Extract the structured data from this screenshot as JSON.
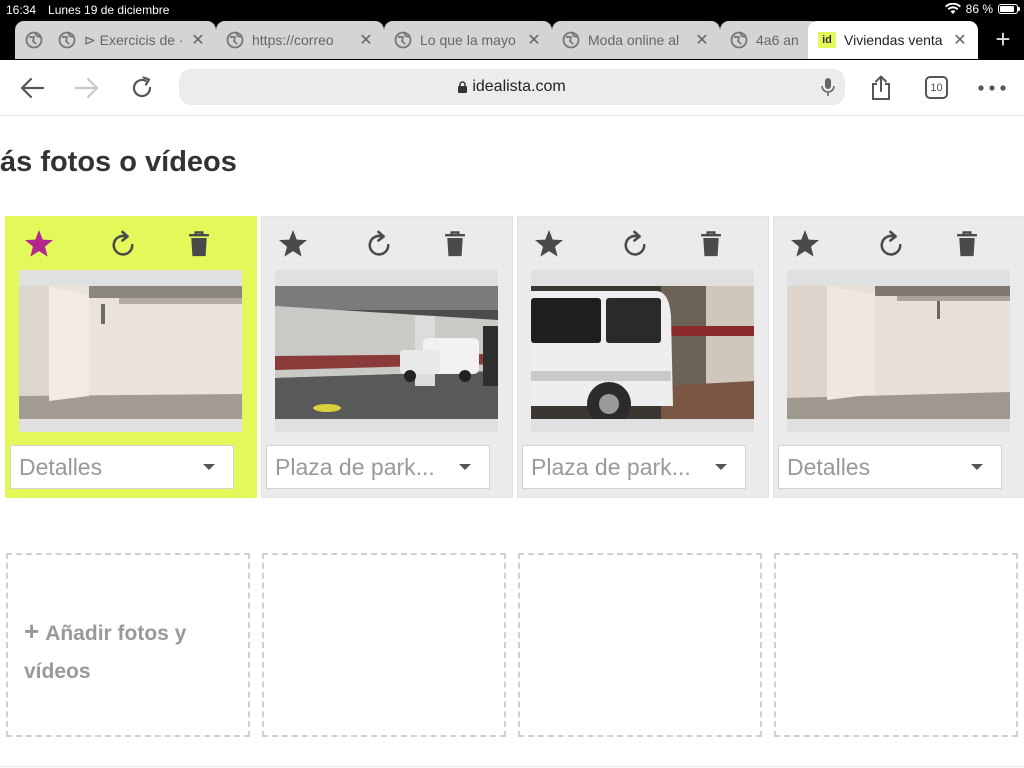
{
  "status_bar": {
    "time": "16:34",
    "date": "Lunes 19 de diciembre",
    "battery": "86 %",
    "battery_level": 0.86
  },
  "tabs": [
    {
      "title": ""
    },
    {
      "title": "⊳ Exercicis de ·"
    },
    {
      "title": "https://correo"
    },
    {
      "title": "Lo que la mayo"
    },
    {
      "title": "Moda online al"
    },
    {
      "title": "4a6 an"
    },
    {
      "title": "Viviendas venta",
      "favicon_text": "id",
      "active": true
    }
  ],
  "toolbar": {
    "url": "idealista.com",
    "tab_count": "10"
  },
  "page": {
    "heading": "ás fotos o vídeos",
    "photos": [
      {
        "tag": "Detalles",
        "featured": true,
        "scene": "empty-garage"
      },
      {
        "tag": "Plaza de park...",
        "featured": false,
        "scene": "parking-van"
      },
      {
        "tag": "Plaza de park...",
        "featured": false,
        "scene": "van-closeup"
      },
      {
        "tag": "Detalles",
        "featured": false,
        "scene": "empty-garage"
      }
    ],
    "add_media_label": "Añadir fotos y vídeos"
  },
  "colors": {
    "featured_bg": "#e3f95a",
    "star_active": "#b2288f",
    "icon": "#4a4a4a"
  }
}
